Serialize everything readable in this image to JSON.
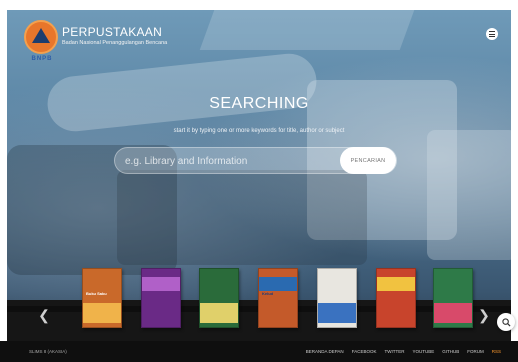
{
  "header": {
    "logo_text": "BNPB",
    "title": "PERPUSTAKAAN",
    "subtitle": "Badan Nasional Penanggulangan Bencana",
    "menu_icon": "hamburger-icon"
  },
  "search": {
    "title": "SEARCHING",
    "hint": "start it by typing one or more keywords for title, author or subject",
    "placeholder": "e.g. Library and Information",
    "value": "",
    "button_label": "PENCARIAN"
  },
  "carousel": {
    "prev_icon": "chevron-left-icon",
    "next_icon": "chevron-right-icon",
    "books": [
      {
        "name": "book-cover-1",
        "color": "#c9692a",
        "band": "#f0b34a",
        "title": "Buku Saku",
        "title_color": "#fff"
      },
      {
        "name": "book-cover-2",
        "color": "#6a2a86",
        "band": "#b060c8",
        "title": "",
        "title_color": "#fff"
      },
      {
        "name": "book-cover-3",
        "color": "#2a6b3a",
        "band": "#e0d06a",
        "title": "",
        "title_color": "#fff"
      },
      {
        "name": "book-cover-4",
        "color": "#c45a2a",
        "band": "#2a6ab0",
        "title": "Kelud",
        "title_color": "#1b3a78"
      },
      {
        "name": "book-cover-5",
        "color": "#e8e6e0",
        "band": "#3a72c0",
        "title": "",
        "title_color": "#1b3a78"
      },
      {
        "name": "book-cover-6",
        "color": "#c8442c",
        "band": "#f1c240",
        "title": "",
        "title_color": "#fff"
      },
      {
        "name": "book-cover-7",
        "color": "#2e7a48",
        "band": "#d84a6a",
        "title": "",
        "title_color": "#fff"
      }
    ]
  },
  "fab": {
    "icon": "search-icon"
  },
  "footer": {
    "left_text": "SLIMS 8 (AKASIA)",
    "links": [
      "BERANDA DEPAN",
      "FACEBOOK",
      "TWITTER",
      "YOUTUBE",
      "GITHUB",
      "FORUM",
      "RSS"
    ]
  }
}
